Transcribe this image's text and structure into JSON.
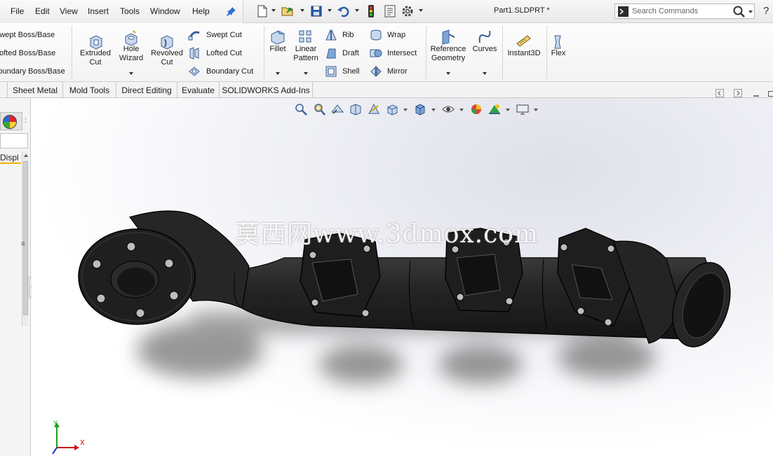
{
  "menu": {
    "items": [
      "File",
      "Edit",
      "View",
      "Insert",
      "Tools",
      "Window",
      "Help"
    ]
  },
  "document": {
    "title": "Part1.SLDPRT *"
  },
  "search": {
    "placeholder": "Search Commands"
  },
  "help_label": "?",
  "ribbon": {
    "features_left": [
      "Swept Boss/Base",
      "Lofted Boss/Base",
      "Boundary Boss/Base"
    ],
    "extruded_cut": "Extruded\nCut",
    "hole_wizard": "Hole\nWizard",
    "revolved_cut": "Revolved\nCut",
    "cuts": [
      "Swept Cut",
      "Lofted Cut",
      "Boundary Cut"
    ],
    "fillet": "Fillet",
    "linear_pattern": "Linear\nPattern",
    "features_mid": [
      "Rib",
      "Draft",
      "Shell"
    ],
    "features_right": [
      "Wrap",
      "Intersect",
      "Mirror"
    ],
    "reference_geometry": "Reference\nGeometry",
    "curves": "Curves",
    "instant3d": "Instant3D",
    "flex": "Flex"
  },
  "tabs": [
    "Sheet Metal",
    "Mold Tools",
    "Direct Editing",
    "Evaluate",
    "SOLIDWORKS Add-Ins"
  ],
  "left_panel": {
    "header": "Displ"
  },
  "viewport": {
    "watermark": "莫西网www.3dmox.com",
    "triad": {
      "x_label": "X",
      "y_label": "Y"
    },
    "model_color": "#232323",
    "background_color": "#ffffff"
  },
  "icons": {
    "quick_access": [
      "new-document-icon",
      "open-icon",
      "save-icon",
      "undo-icon",
      "rebuild-icon",
      "file-properties-icon",
      "options-icon"
    ],
    "heads_up": [
      "zoom-to-fit-icon",
      "zoom-to-area-icon",
      "previous-view-icon",
      "section-view-icon",
      "dynamic-annotation-icon",
      "view-orientation-icon",
      "display-style-icon",
      "hide-show-items-icon",
      "edit-appearance-icon",
      "apply-scene-icon",
      "view-settings-icon"
    ]
  },
  "colors": {
    "accent": "#f0b400",
    "ribbon_bg": "#f3f3f3"
  }
}
